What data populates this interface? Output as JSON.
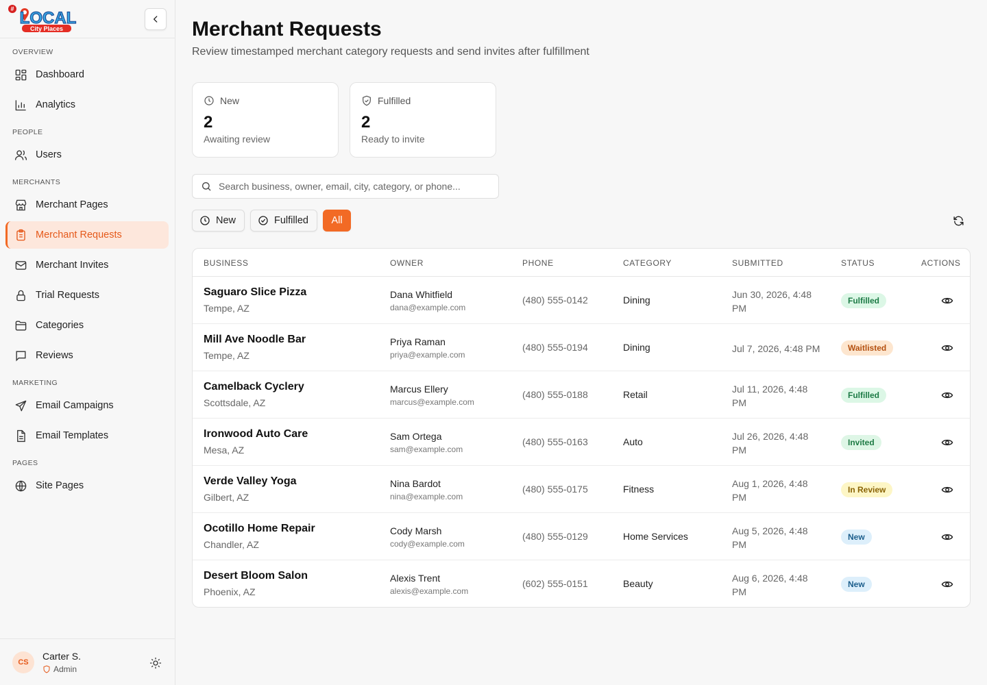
{
  "brand": {
    "logo_main": "LOCAL",
    "logo_tag": "City Places",
    "logo_hash": "#"
  },
  "sidebar": {
    "sections": {
      "overview": "OVERVIEW",
      "people": "PEOPLE",
      "merchants": "MERCHANTS",
      "marketing": "MARKETING",
      "pages": "PAGES"
    },
    "items": [
      {
        "label": "Dashboard",
        "icon": "dashboard-icon"
      },
      {
        "label": "Analytics",
        "icon": "analytics-icon"
      },
      {
        "label": "Users",
        "icon": "users-icon"
      },
      {
        "label": "Merchant Pages",
        "icon": "store-icon"
      },
      {
        "label": "Merchant Requests",
        "icon": "clipboard-icon",
        "active": true
      },
      {
        "label": "Merchant Invites",
        "icon": "mail-icon"
      },
      {
        "label": "Trial Requests",
        "icon": "lock-icon"
      },
      {
        "label": "Categories",
        "icon": "folder-icon"
      },
      {
        "label": "Reviews",
        "icon": "message-icon"
      },
      {
        "label": "Email Campaigns",
        "icon": "send-icon"
      },
      {
        "label": "Email Templates",
        "icon": "file-icon"
      },
      {
        "label": "Site Pages",
        "icon": "globe-icon"
      }
    ],
    "user": {
      "initials": "CS",
      "name": "Carter S.",
      "role": "Admin"
    }
  },
  "header": {
    "title": "Merchant Requests",
    "subtitle": "Review timestamped merchant category requests and send invites after fulfillment"
  },
  "stats": [
    {
      "label": "New",
      "value": "2",
      "desc": "Awaiting review",
      "icon": "clock-icon"
    },
    {
      "label": "Fulfilled",
      "value": "2",
      "desc": "Ready to invite",
      "icon": "shield-check-icon"
    }
  ],
  "search": {
    "placeholder": "Search business, owner, email, city, category, or phone..."
  },
  "filters": [
    {
      "label": "New",
      "icon": "clock-icon"
    },
    {
      "label": "Fulfilled",
      "icon": "check-circle-icon"
    },
    {
      "label": "All",
      "active": true
    }
  ],
  "table": {
    "columns": [
      "BUSINESS",
      "OWNER",
      "PHONE",
      "CATEGORY",
      "SUBMITTED",
      "STATUS",
      "ACTIONS"
    ],
    "rows": [
      {
        "business": "Saguaro Slice Pizza",
        "city": "Tempe, AZ",
        "owner": "Dana Whitfield",
        "email": "dana@example.com",
        "phone": "(480) 555-0142",
        "category": "Dining",
        "submitted": "Jun 30, 2026, 4:48 PM",
        "status": "Fulfilled"
      },
      {
        "business": "Mill Ave Noodle Bar",
        "city": "Tempe, AZ",
        "owner": "Priya Raman",
        "email": "priya@example.com",
        "phone": "(480) 555-0194",
        "category": "Dining",
        "submitted": "Jul 7, 2026, 4:48 PM",
        "status": "Waitlisted"
      },
      {
        "business": "Camelback Cyclery",
        "city": "Scottsdale, AZ",
        "owner": "Marcus Ellery",
        "email": "marcus@example.com",
        "phone": "(480) 555-0188",
        "category": "Retail",
        "submitted": "Jul 11, 2026, 4:48 PM",
        "status": "Fulfilled"
      },
      {
        "business": "Ironwood Auto Care",
        "city": "Mesa, AZ",
        "owner": "Sam Ortega",
        "email": "sam@example.com",
        "phone": "(480) 555-0163",
        "category": "Auto",
        "submitted": "Jul 26, 2026, 4:48 PM",
        "status": "Invited"
      },
      {
        "business": "Verde Valley Yoga",
        "city": "Gilbert, AZ",
        "owner": "Nina Bardot",
        "email": "nina@example.com",
        "phone": "(480) 555-0175",
        "category": "Fitness",
        "submitted": "Aug 1, 2026, 4:48 PM",
        "status": "In Review"
      },
      {
        "business": "Ocotillo Home Repair",
        "city": "Chandler, AZ",
        "owner": "Cody Marsh",
        "email": "cody@example.com",
        "phone": "(480) 555-0129",
        "category": "Home Services",
        "submitted": "Aug 5, 2026, 4:48 PM",
        "status": "New"
      },
      {
        "business": "Desert Bloom Salon",
        "city": "Phoenix, AZ",
        "owner": "Alexis Trent",
        "email": "alexis@example.com",
        "phone": "(602) 555-0151",
        "category": "Beauty",
        "submitted": "Aug 6, 2026, 4:48 PM",
        "status": "New"
      }
    ]
  },
  "colors": {
    "accent": "#f26a25",
    "active_bg": "#fde7dc"
  }
}
